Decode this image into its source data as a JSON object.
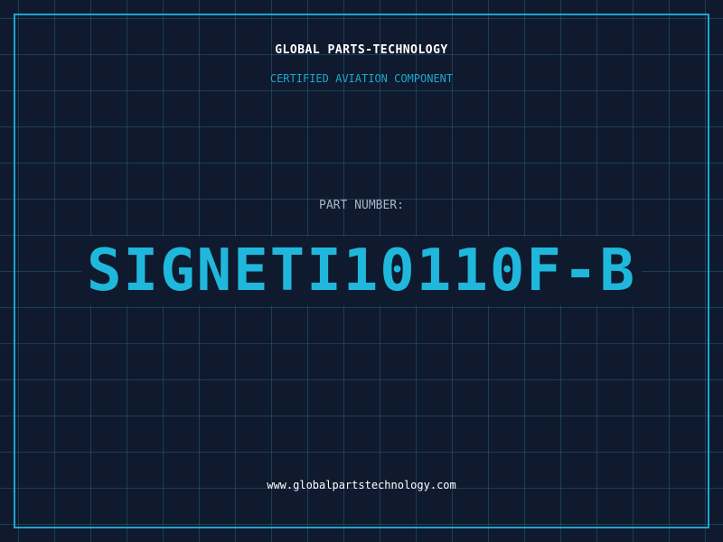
{
  "header": {
    "company": "GLOBAL PARTS-TECHNOLOGY",
    "subtitle": "CERTIFIED AVIATION COMPONENT"
  },
  "part": {
    "label": "PART NUMBER:",
    "number": "SIGNETI10110F-B"
  },
  "footer": {
    "url": "www.globalpartstechnology.com"
  },
  "colors": {
    "background": "#0f1a2e",
    "accent": "#1fa6cc",
    "part_number": "#1fb8dc",
    "label": "#a9b4c4",
    "text": "#ffffff"
  }
}
